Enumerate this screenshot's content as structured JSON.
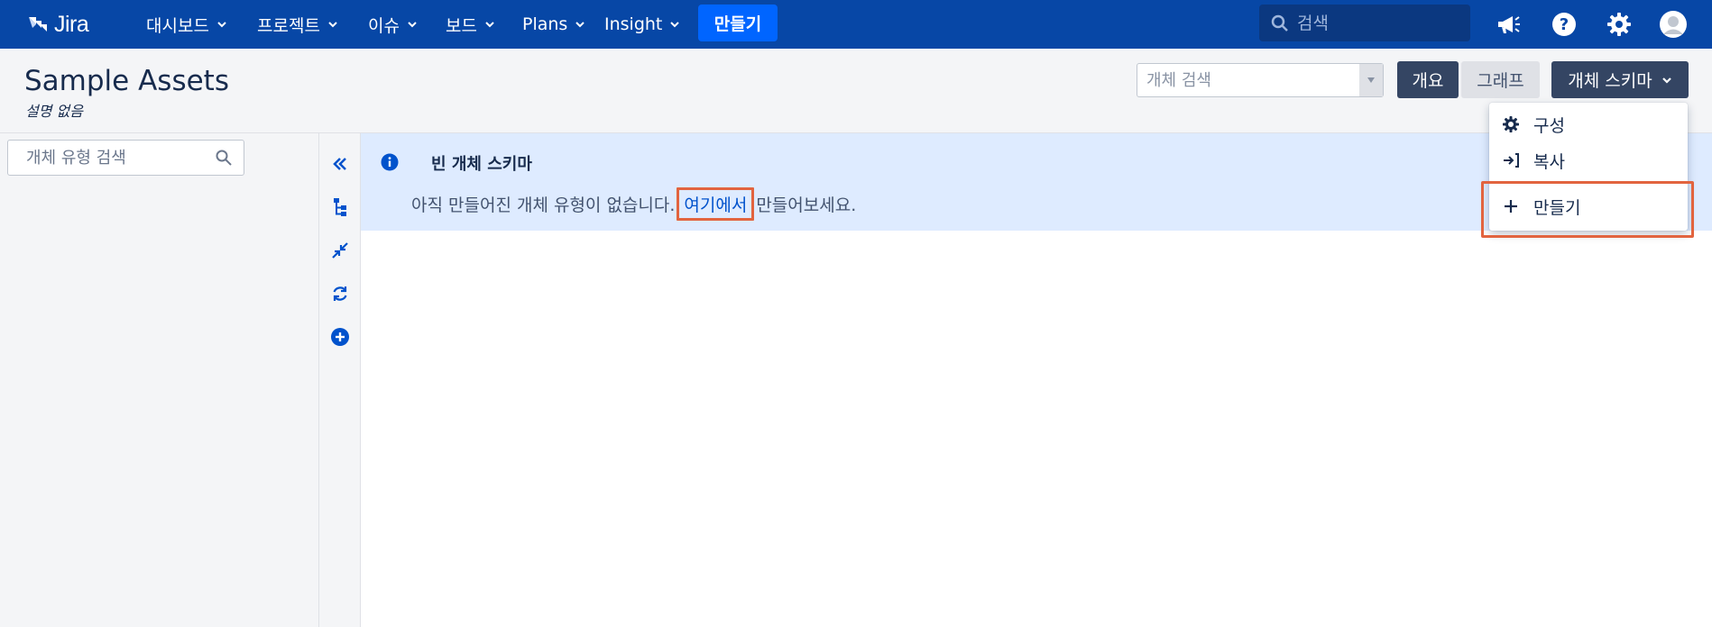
{
  "topnav": {
    "logo_text": "Jira",
    "menu": [
      {
        "label": "대시보드"
      },
      {
        "label": "프로젝트"
      },
      {
        "label": "이슈"
      },
      {
        "label": "보드"
      },
      {
        "label": "Plans"
      },
      {
        "label": "Insight"
      }
    ],
    "create_label": "만들기",
    "search_placeholder": "검색",
    "icons": [
      "megaphone-icon",
      "help-icon",
      "settings-icon",
      "avatar-icon"
    ]
  },
  "header": {
    "title": "Sample Assets",
    "description": "설명 없음",
    "object_search_placeholder": "개체 검색",
    "overview_label": "개요",
    "graph_label": "그래프",
    "schema_label": "개체 스키마"
  },
  "sidebar": {
    "type_search_placeholder": "개체 유형 검색"
  },
  "info": {
    "title": "빈 개체 스키마",
    "text_before": "아직 만들어진 개체 유형이 없습니다.",
    "link": "여기에서",
    "text_after": "만들어보세요."
  },
  "dropdown": {
    "items": [
      {
        "label": "구성",
        "icon": "gear-icon"
      },
      {
        "label": "복사",
        "icon": "copy-arrow-icon"
      },
      {
        "label": "만들기",
        "icon": "plus-icon"
      }
    ]
  },
  "colors": {
    "nav_bg": "#0747a6",
    "primary": "#0065ff",
    "dark_button": "#344563",
    "info_bg": "#deebff",
    "highlight": "#e2643f"
  }
}
